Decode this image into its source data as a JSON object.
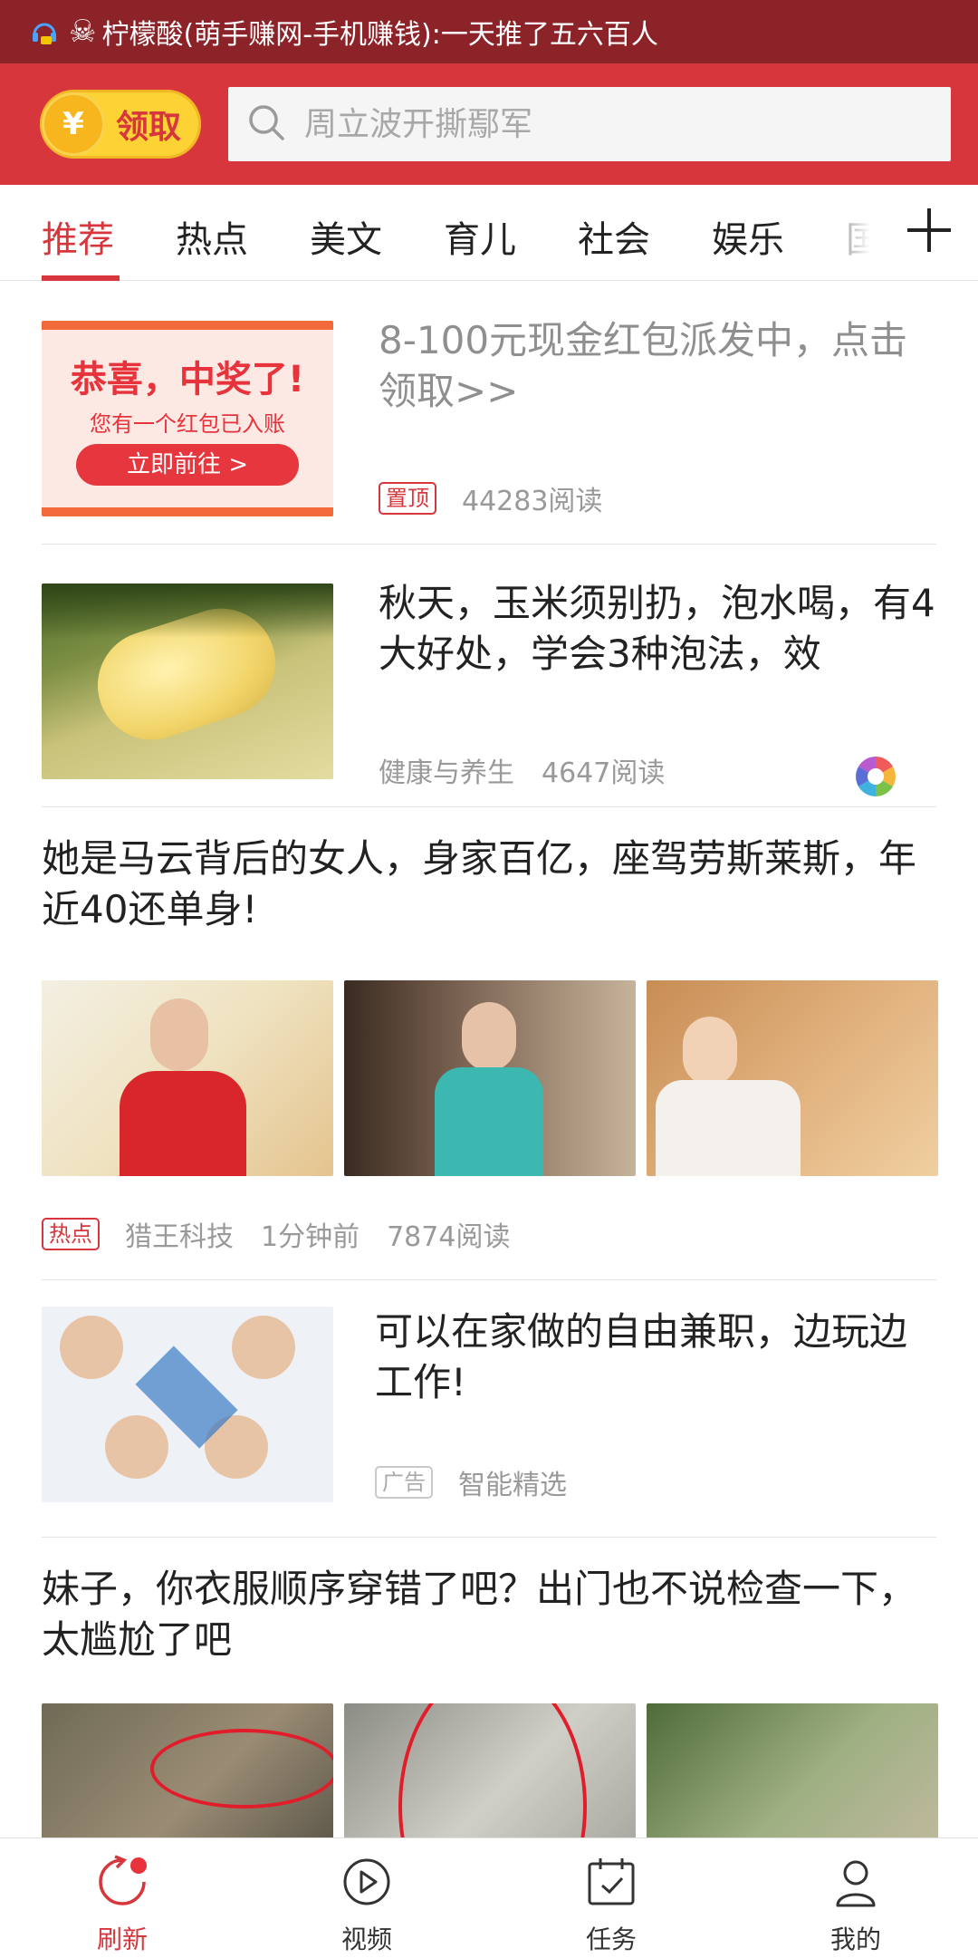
{
  "status_bar": {
    "notification_text": "柠檬酸(萌手赚网-手机赚钱):一天推了五六百人"
  },
  "header": {
    "claim_label": "领取",
    "coin_symbol": "¥",
    "search_placeholder": "周立波开撕鄢军"
  },
  "tabs": [
    {
      "label": "推荐",
      "active": true
    },
    {
      "label": "热点"
    },
    {
      "label": "美文"
    },
    {
      "label": "育儿"
    },
    {
      "label": "社会"
    },
    {
      "label": "娱乐"
    },
    {
      "label": "国"
    }
  ],
  "feed": [
    {
      "type": "single-image",
      "title": "8-100元现金红包派发中，点击领取>>",
      "tag": "置顶",
      "reads": "44283阅读",
      "banner": {
        "headline": "恭喜，中奖了!",
        "sub": "您有一个红包已入账",
        "button": "立即前往 >"
      }
    },
    {
      "type": "single-image",
      "title": "秋天，玉米须别扔，泡水喝，有4大好处，学会3种泡法，效",
      "source": "健康与养生",
      "reads": "4647阅读",
      "image": "corn"
    },
    {
      "type": "three-images",
      "title": "她是马云背后的女人，身家百亿，座驾劳斯莱斯，年近40还单身!",
      "tag": "热点",
      "source": "猎王科技",
      "time": "1分钟前",
      "reads": "7874阅读"
    },
    {
      "type": "single-image",
      "title": "可以在家做的自由兼职，边玩边工作!",
      "tag": "广告",
      "source": "智能精选"
    },
    {
      "type": "three-images",
      "title": "妹子，你衣服顺序穿错了吧？出门也不说检查一下，太尴尬了吧"
    }
  ],
  "bottom_nav": [
    {
      "label": "刷新",
      "icon": "refresh-icon",
      "active": true
    },
    {
      "label": "视频",
      "icon": "play-icon"
    },
    {
      "label": "任务",
      "icon": "task-calendar-icon"
    },
    {
      "label": "我的",
      "icon": "user-icon"
    }
  ],
  "colors": {
    "brand_red": "#d7363d",
    "status_bar": "#8b2329",
    "gold": "#fcd234"
  }
}
